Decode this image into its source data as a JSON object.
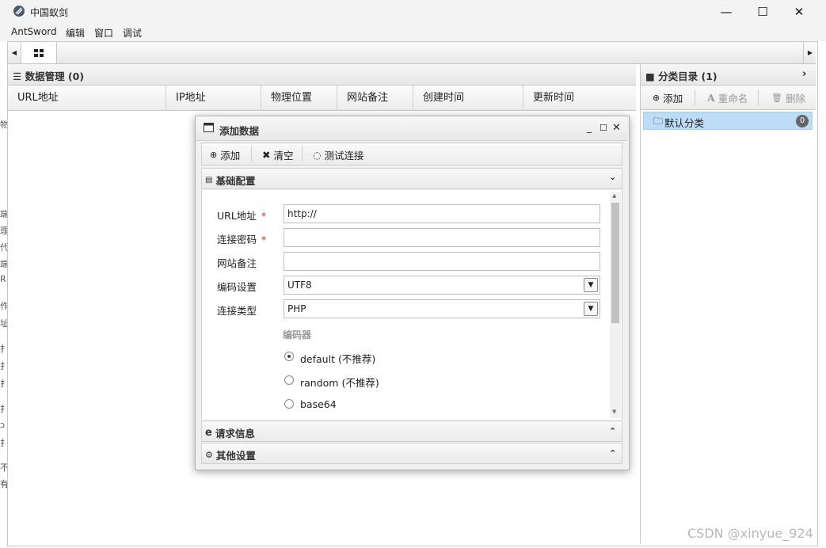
{
  "window": {
    "title": "中国蚁剑",
    "controls": {
      "minimize": "—",
      "maximize": "☐",
      "close": "✕"
    }
  },
  "menu": [
    "AntSword",
    "编辑",
    "窗口",
    "调试"
  ],
  "data_manager": {
    "title": "数据管理 (0)",
    "columns": [
      "URL地址",
      "IP地址",
      "物理位置",
      "网站备注",
      "创建时间",
      "更新时间"
    ]
  },
  "left_clipped": [
    "物",
    "端",
    "理",
    "代",
    "端",
    "R",
    "作",
    "址",
    "扌",
    "扌",
    "扌",
    "扌",
    "ɔ",
    "扌",
    "不",
    "有"
  ],
  "category": {
    "title": "分类目录 (1)",
    "toolbar": {
      "add": "添加",
      "rename": "重命名",
      "delete": "删除"
    },
    "items": [
      {
        "label": "默认分类",
        "count": "0"
      }
    ]
  },
  "dialog": {
    "title": "添加数据",
    "toolbar": {
      "add": "添加",
      "clear": "清空",
      "test": "测试连接"
    },
    "sections": {
      "basic": "基础配置",
      "request": "请求信息",
      "other": "其他设置"
    },
    "form": {
      "url_label": "URL地址",
      "url_value": "http://",
      "password_label": "连接密码",
      "password_value": "",
      "note_label": "网站备注",
      "note_value": "",
      "encoding_label": "编码设置",
      "encoding_value": "UTF8",
      "type_label": "连接类型",
      "type_value": "PHP",
      "encoder_label": "编码器",
      "required_mark": "*",
      "encoders": [
        {
          "label": "default (不推荐)",
          "checked": true
        },
        {
          "label": "random (不推荐)",
          "checked": false
        },
        {
          "label": "base64",
          "checked": false
        }
      ]
    }
  },
  "watermark": "CSDN @xinyue_924"
}
